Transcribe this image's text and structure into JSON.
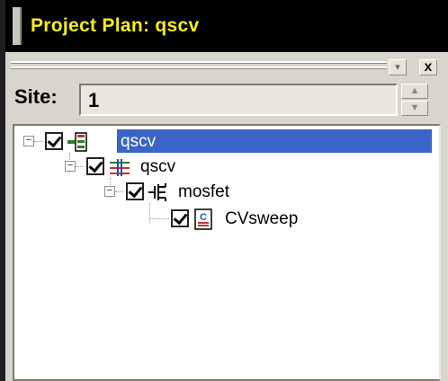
{
  "window": {
    "title": "Project Plan: qscv"
  },
  "panel": {
    "dropdown_icon": "dropdown-arrow-icon",
    "close_glyph": "x"
  },
  "site": {
    "label": "Site:",
    "value": "1"
  },
  "tree": {
    "nodes": [
      {
        "label": "qscv",
        "icon": "project-icon",
        "checked": true,
        "selected": true
      },
      {
        "label": "qscv",
        "icon": "device-group-icon",
        "checked": true,
        "selected": false
      },
      {
        "label": "mosfet",
        "icon": "mosfet-icon",
        "checked": true,
        "selected": false
      },
      {
        "label": "CVsweep",
        "icon": "test-document-icon",
        "checked": true,
        "selected": false
      }
    ]
  },
  "colors": {
    "title_bg": "#000000",
    "title_text": "#f6ee1b",
    "selection": "#3a64c6"
  }
}
